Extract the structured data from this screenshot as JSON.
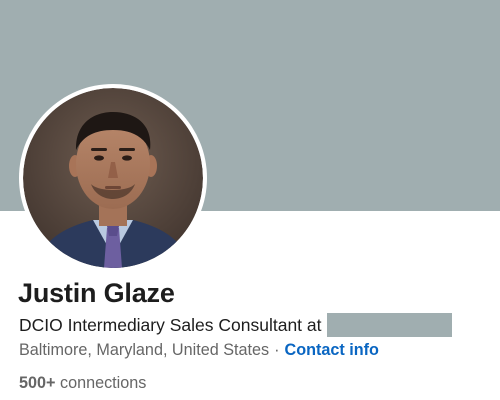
{
  "profile": {
    "name": "Justin Glaze",
    "headline": "DCIO Intermediary Sales Consultant at",
    "headline_company_redacted": true,
    "location": "Baltimore, Maryland, United States",
    "separator": "·",
    "contact_link_label": "Contact info",
    "connections_count": "500+",
    "connections_label": "connections"
  },
  "colors": {
    "banner": "#a0aeb0",
    "redaction": "#a0aeb0",
    "link": "#0a66c2",
    "name_text": "#1d1d1d",
    "secondary_text": "#666666"
  },
  "icons": {
    "avatar": "profile-photo"
  }
}
